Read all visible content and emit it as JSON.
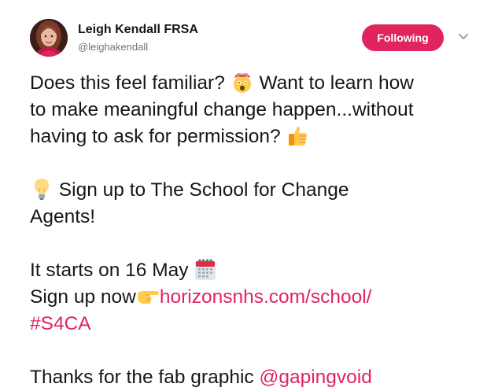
{
  "tweet": {
    "author": {
      "name": "Leigh Kendall FRSA",
      "handle": "@leighakendall"
    },
    "follow_label": "Following",
    "body": {
      "line1a": "Does this feel familiar? ",
      "line1b": " Want to learn how",
      "line2": "to make meaningful change happen...without",
      "line3": "having to ask for permission? ",
      "line4": " Sign up to The School for Change",
      "line5": "Agents!",
      "line6": "It starts on 16 May ",
      "line7a": "Sign up now",
      "link_url": "horizonsnhs.com/school/",
      "hashtag": "#S4CA",
      "line9a": "Thanks for the fab graphic ",
      "mention": "@gapingvoid"
    },
    "emoji_icons": [
      "exploding-head",
      "thumbs-up",
      "light-bulb",
      "calendar",
      "pointing-right"
    ],
    "colors": {
      "accent": "#e0245e",
      "text": "#14171a",
      "secondary": "#657786"
    }
  }
}
